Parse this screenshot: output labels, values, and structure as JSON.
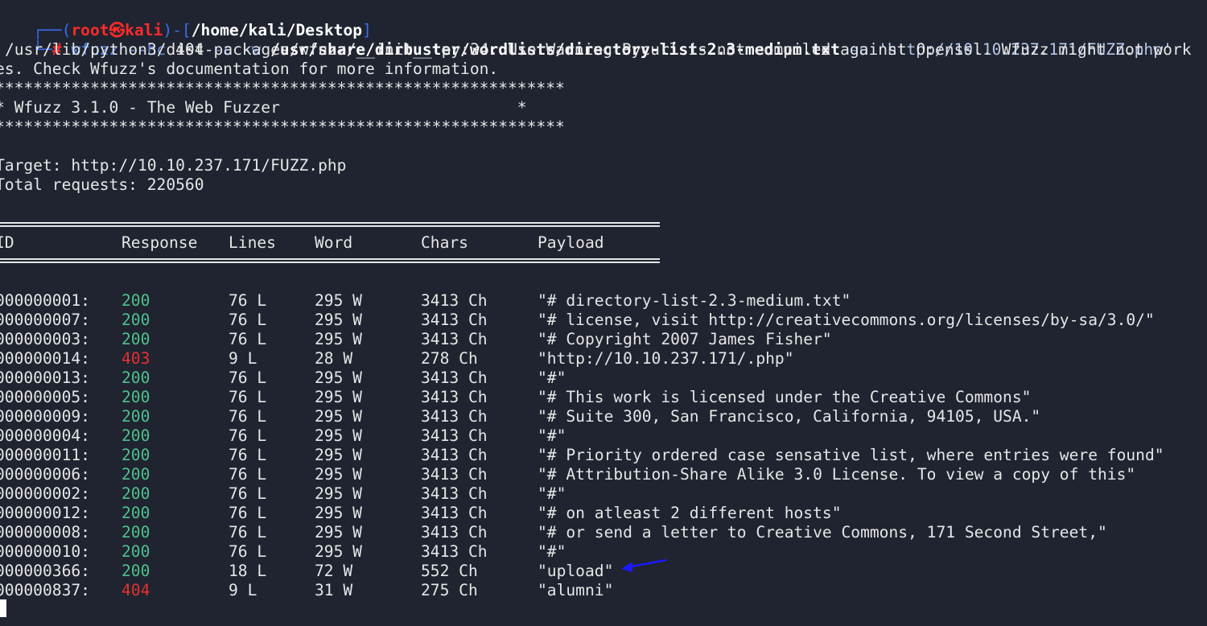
{
  "prompt": {
    "user": "root",
    "host": "kali",
    "symbol": "㉿",
    "path": "/home/kali/Desktop",
    "hash": "#"
  },
  "command": {
    "program": "wfuzz",
    "opt_hc": "--hc",
    "hc_value": "404",
    "opt_c": "-c",
    "opt_w": "-w",
    "wordlist": "/usr/share/dirbuster/wordlists/directory-list-2.3-medium.txt",
    "opt_u": "-u",
    "url": "'http://10.10.237.171/FUZZ.php'"
  },
  "warning": {
    "line1": "/usr/lib/python3/dist-packages/wfuzz/__init__.py:34: UserWarning:Pycurl is not compiled against Openssl. Wfuzz might not work",
    "line2": "es. Check Wfuzz's documentation for more information."
  },
  "banner": {
    "stars": "************************************************************",
    "title": "* Wfuzz 3.1.0 - The Web Fuzzer                         *"
  },
  "target_line": "Target: http://10.10.237.171/FUZZ.php",
  "total_line": "Total requests: 220560",
  "table": {
    "headers": [
      "ID",
      "Response",
      "Lines",
      "Word",
      "Chars",
      "Payload"
    ],
    "rows": [
      {
        "id": "000000001:",
        "code": "200",
        "lines": "76 L",
        "word": "295 W",
        "chars": "3413 Ch",
        "payload": "\"# directory-list-2.3-medium.txt\""
      },
      {
        "id": "000000007:",
        "code": "200",
        "lines": "76 L",
        "word": "295 W",
        "chars": "3413 Ch",
        "payload": "\"# license, visit http://creativecommons.org/licenses/by-sa/3.0/\""
      },
      {
        "id": "000000003:",
        "code": "200",
        "lines": "76 L",
        "word": "295 W",
        "chars": "3413 Ch",
        "payload": "\"# Copyright 2007 James Fisher\""
      },
      {
        "id": "000000014:",
        "code": "403",
        "lines": "9 L",
        "word": "28 W",
        "chars": "278 Ch",
        "payload": "\"http://10.10.237.171/.php\""
      },
      {
        "id": "000000013:",
        "code": "200",
        "lines": "76 L",
        "word": "295 W",
        "chars": "3413 Ch",
        "payload": "\"#\""
      },
      {
        "id": "000000005:",
        "code": "200",
        "lines": "76 L",
        "word": "295 W",
        "chars": "3413 Ch",
        "payload": "\"# This work is licensed under the Creative Commons\""
      },
      {
        "id": "000000009:",
        "code": "200",
        "lines": "76 L",
        "word": "295 W",
        "chars": "3413 Ch",
        "payload": "\"# Suite 300, San Francisco, California, 94105, USA.\""
      },
      {
        "id": "000000004:",
        "code": "200",
        "lines": "76 L",
        "word": "295 W",
        "chars": "3413 Ch",
        "payload": "\"#\""
      },
      {
        "id": "000000011:",
        "code": "200",
        "lines": "76 L",
        "word": "295 W",
        "chars": "3413 Ch",
        "payload": "\"# Priority ordered case sensative list, where entries were found\""
      },
      {
        "id": "000000006:",
        "code": "200",
        "lines": "76 L",
        "word": "295 W",
        "chars": "3413 Ch",
        "payload": "\"# Attribution-Share Alike 3.0 License. To view a copy of this\""
      },
      {
        "id": "000000002:",
        "code": "200",
        "lines": "76 L",
        "word": "295 W",
        "chars": "3413 Ch",
        "payload": "\"#\""
      },
      {
        "id": "000000012:",
        "code": "200",
        "lines": "76 L",
        "word": "295 W",
        "chars": "3413 Ch",
        "payload": "\"# on atleast 2 different hosts\""
      },
      {
        "id": "000000008:",
        "code": "200",
        "lines": "76 L",
        "word": "295 W",
        "chars": "3413 Ch",
        "payload": "\"# or send a letter to Creative Commons, 171 Second Street,\""
      },
      {
        "id": "000000010:",
        "code": "200",
        "lines": "76 L",
        "word": "295 W",
        "chars": "3413 Ch",
        "payload": "\"#\""
      },
      {
        "id": "000000366:",
        "code": "200",
        "lines": "18 L",
        "word": "72 W",
        "chars": "552 Ch",
        "payload": "\"upload\""
      },
      {
        "id": "000000837:",
        "code": "404",
        "lines": "9 L",
        "word": "31 W",
        "chars": "275 Ch",
        "payload": "\"alumni\""
      }
    ]
  },
  "colors": {
    "background": "#1f2430",
    "ok_200": "#4fc08d",
    "err_4xx": "#e63030",
    "prompt_blue": "#3b6df0",
    "annotation_arrow": "#1a1aff"
  },
  "annotation": {
    "type": "arrow-icon",
    "points_to": "upload"
  }
}
